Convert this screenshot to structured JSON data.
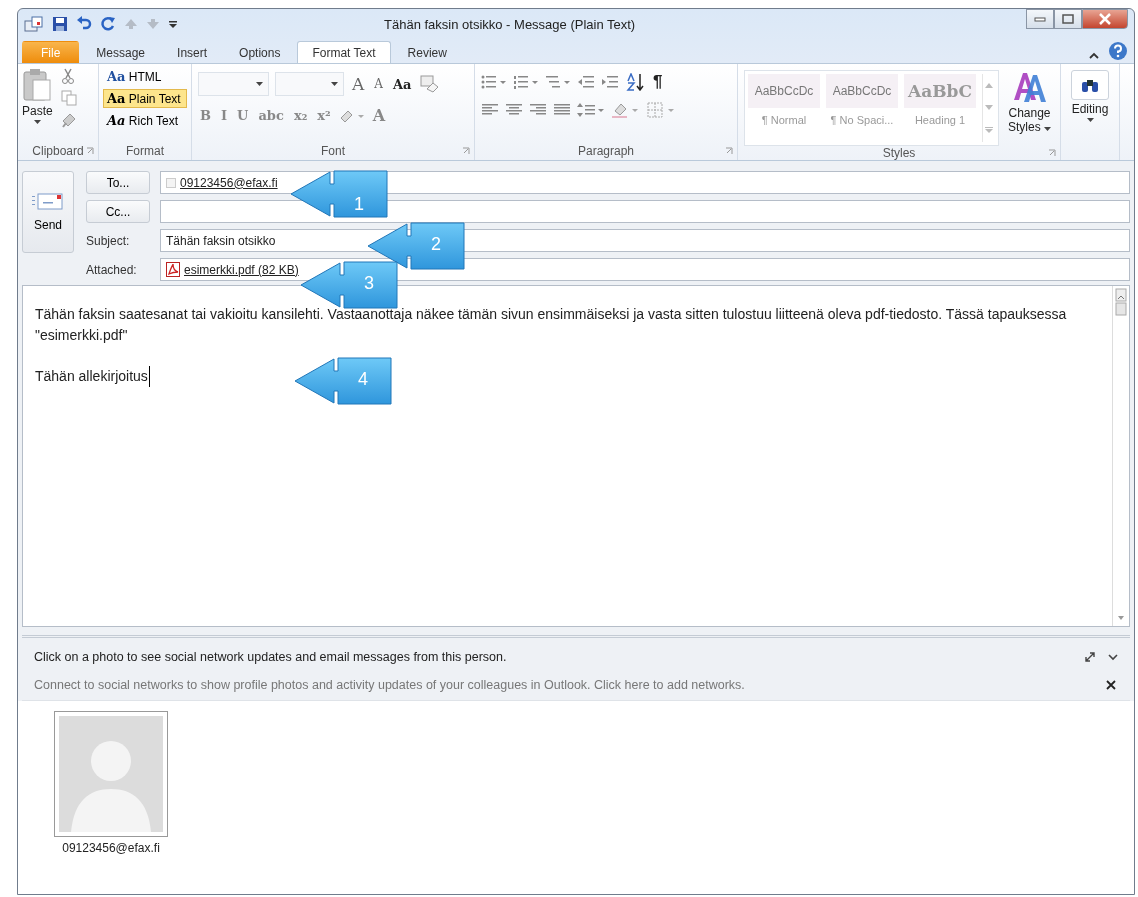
{
  "window": {
    "title": "Tähän faksin otsikko  -  Message (Plain Text)"
  },
  "ribbon_tabs": [
    {
      "label": "File",
      "kind": "file",
      "selected": false
    },
    {
      "label": "Message",
      "kind": "tab",
      "selected": false
    },
    {
      "label": "Insert",
      "kind": "tab",
      "selected": false
    },
    {
      "label": "Options",
      "kind": "tab",
      "selected": false
    },
    {
      "label": "Format Text",
      "kind": "tab",
      "selected": true
    },
    {
      "label": "Review",
      "kind": "tab",
      "selected": false
    }
  ],
  "ribbon": {
    "clipboard": {
      "label": "Clipboard",
      "paste": "Paste"
    },
    "format": {
      "label": "Format",
      "options": [
        {
          "icon": "Aa",
          "label": "HTML",
          "selected": false
        },
        {
          "icon": "Aa",
          "label": "Plain Text",
          "selected": true
        },
        {
          "icon": "Aa",
          "label": "Rich Text",
          "selected": false
        }
      ]
    },
    "font": {
      "label": "Font",
      "top_buttons": [
        "A",
        "A",
        "Aa"
      ],
      "bottom_buttons": [
        "B",
        "I",
        "U",
        "abc",
        "x₂",
        "x²"
      ],
      "color_button": "A"
    },
    "paragraph": {
      "label": "Paragraph",
      "mark": "¶"
    },
    "styles": {
      "label": "Styles",
      "gallery": [
        {
          "sample": "AaBbCcDc",
          "name": "¶ Normal",
          "kind": "plain"
        },
        {
          "sample": "AaBbCcDc",
          "name": "¶ No Spaci...",
          "kind": "plain"
        },
        {
          "sample": "AaBbC",
          "name": "Heading 1",
          "kind": "heading"
        }
      ],
      "change_styles": "Change Styles"
    },
    "editing": "Editing"
  },
  "send_button": "Send",
  "to": {
    "button": "To...",
    "value": "09123456@efax.fi"
  },
  "cc": {
    "button": "Cc..."
  },
  "subject": {
    "label": "Subject:",
    "value": "Tähän faksin otsikko"
  },
  "attached": {
    "label": "Attached:",
    "file": "esimerkki.pdf (82 KB)"
  },
  "body": {
    "paragraphs": [
      "Tähän faksin saatesanat tai vakioitu kansilehti. Vastaanottaja näkee tämän sivun ensimmäiseksi ja vasta sitten tulostuu liitteenä oleva pdf-tiedosto. Tässä tapauksessa \"esimerkki.pdf\"",
      "Tähän allekirjoitus"
    ]
  },
  "callouts": [
    {
      "number": "1"
    },
    {
      "number": "2"
    },
    {
      "number": "3"
    },
    {
      "number": "4"
    }
  ],
  "social": {
    "hint": "Click on a photo to see social network updates and email messages from this person.",
    "connect": "Connect to social networks to show profile photos and activity updates of your colleagues in Outlook. Click here to add networks.",
    "contacts": [
      {
        "name": "09123456@efax.fi"
      }
    ]
  }
}
